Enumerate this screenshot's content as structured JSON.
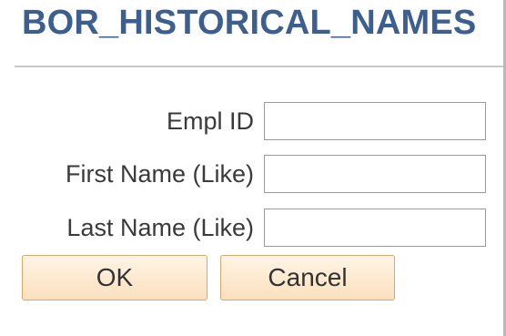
{
  "page": {
    "title": "BOR_HISTORICAL_NAMES"
  },
  "form": {
    "fields": [
      {
        "label": "Empl ID",
        "value": ""
      },
      {
        "label": "First Name (Like)",
        "value": ""
      },
      {
        "label": "Last Name (Like)",
        "value": ""
      }
    ]
  },
  "buttons": {
    "ok_label": "OK",
    "cancel_label": "Cancel"
  },
  "colors": {
    "title": "#3d5f8f",
    "button_fill": "#fbe0bd",
    "button_border": "#d9a86a"
  }
}
